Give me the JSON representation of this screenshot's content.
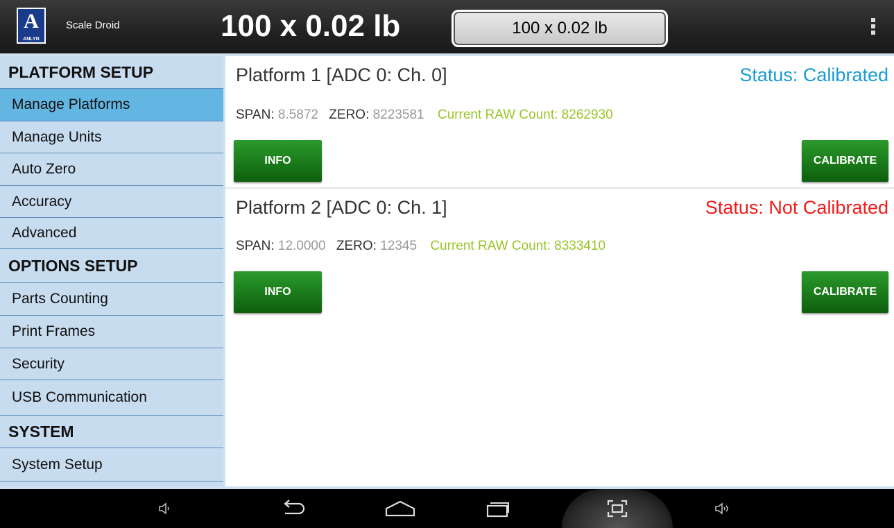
{
  "app": {
    "name": "Scale Droid",
    "logo_letter": "A",
    "logo_text": "ANLYN"
  },
  "header": {
    "weight_display": "100 x 0.02 lb",
    "weight_box": "100 x 0.02 lb"
  },
  "sidebar": {
    "items": [
      {
        "label": "PLATFORM SETUP",
        "type": "header"
      },
      {
        "label": "Manage Platforms",
        "type": "item",
        "active": true
      },
      {
        "label": "Manage Units",
        "type": "item"
      },
      {
        "label": "Auto Zero",
        "type": "item"
      },
      {
        "label": "Accuracy",
        "type": "item"
      },
      {
        "label": "Advanced",
        "type": "item"
      },
      {
        "label": "OPTIONS SETUP",
        "type": "header"
      },
      {
        "label": "Parts Counting",
        "type": "item"
      },
      {
        "label": "Print Frames",
        "type": "item"
      },
      {
        "label": "Security",
        "type": "item"
      },
      {
        "label": "USB Communication",
        "type": "item"
      },
      {
        "label": "SYSTEM",
        "type": "header"
      },
      {
        "label": "System Setup",
        "type": "item"
      }
    ]
  },
  "platforms": [
    {
      "title": "Platform 1 [ADC 0: Ch. 0]",
      "status": "Status: Calibrated",
      "status_color": "#1a9ad6",
      "span_label": "SPAN:",
      "span_value": "8.5872",
      "zero_label": "ZERO:",
      "zero_value": "8223581",
      "raw_count": "Current RAW Count: 8262930",
      "info_label": "INFO",
      "calibrate_label": "CALIBRATE"
    },
    {
      "title": "Platform 2 [ADC 0: Ch. 1]",
      "status": "Status: Not Calibrated",
      "status_color": "#ee1c1c",
      "span_label": "SPAN:",
      "span_value": "12.0000",
      "zero_label": "ZERO:",
      "zero_value": "12345",
      "raw_count": "Current RAW Count: 8333410",
      "info_label": "INFO",
      "calibrate_label": "CALIBRATE"
    }
  ],
  "navbar": {
    "icons": [
      "volume-down-icon",
      "back-icon",
      "home-icon",
      "recent-apps-icon",
      "screenshot-icon",
      "volume-up-icon"
    ]
  }
}
